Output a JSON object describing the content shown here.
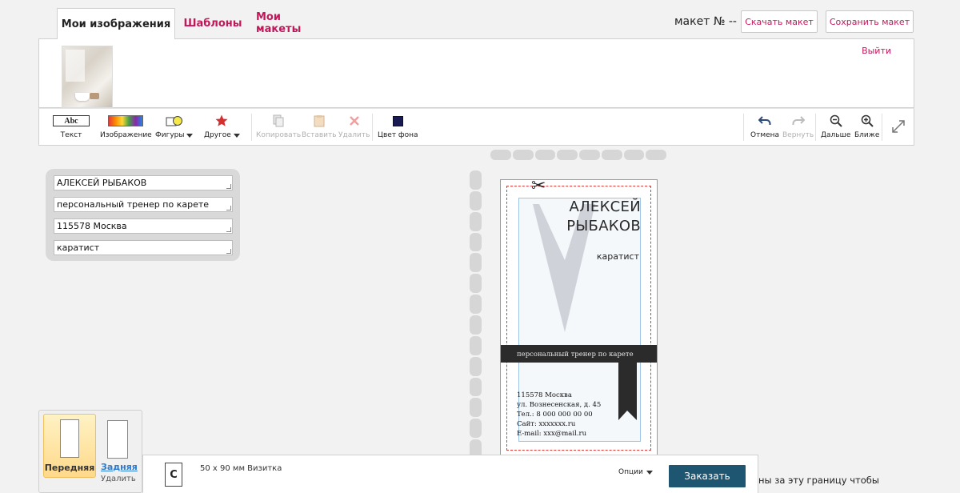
{
  "tabs": {
    "my_images": "Мои изображения",
    "templates": "Шаблоны",
    "my_makets": "Мои макеты"
  },
  "header": {
    "maket_no": "макет № --",
    "download": "Скачать макет",
    "save": "Сохранить макет",
    "logout": "Выйти"
  },
  "toolbar": {
    "text_icon": "Abc",
    "text": "Текст",
    "image": "Изображение",
    "shapes": "Фигуры",
    "other": "Другое",
    "copy": "Копировать",
    "paste": "Вставить",
    "delete": "Удалить",
    "bg_color": "Цвет фона",
    "undo": "Отмена",
    "redo": "Вернуть",
    "zoom_out": "Дальше",
    "zoom_in": "Ближе",
    "bg_color_value": "#1a1a52"
  },
  "fields": [
    "АЛЕКСЕЙ РЫБАКОВ",
    "персональный тренер по карете",
    "115578 Москва",
    "каратист"
  ],
  "card": {
    "name_line1": "АЛЕКСЕЙ",
    "name_line2": "РЫБАКОВ",
    "role": "каратист",
    "band": "персональный тренер по карете",
    "contacts": [
      "115578 Москва",
      "ул. Вознесенская, д. 45",
      "Тел.: 8 000 000 00 00",
      "Сайт: xxxxxxx.ru",
      "E-mail: xxx@mail.ru"
    ]
  },
  "sides": {
    "front": "Передняя",
    "back": "Задняя",
    "delete": "Удалить"
  },
  "bottom": {
    "doc_letter": "C",
    "product": "50 x 90 мм Визитка",
    "options": "Опции",
    "order": "Заказать",
    "hint": "ны за эту границу чтобы"
  },
  "colors": {
    "accent": "#c2185b",
    "order_button": "#1e5570",
    "band": "#2b2b2b"
  }
}
